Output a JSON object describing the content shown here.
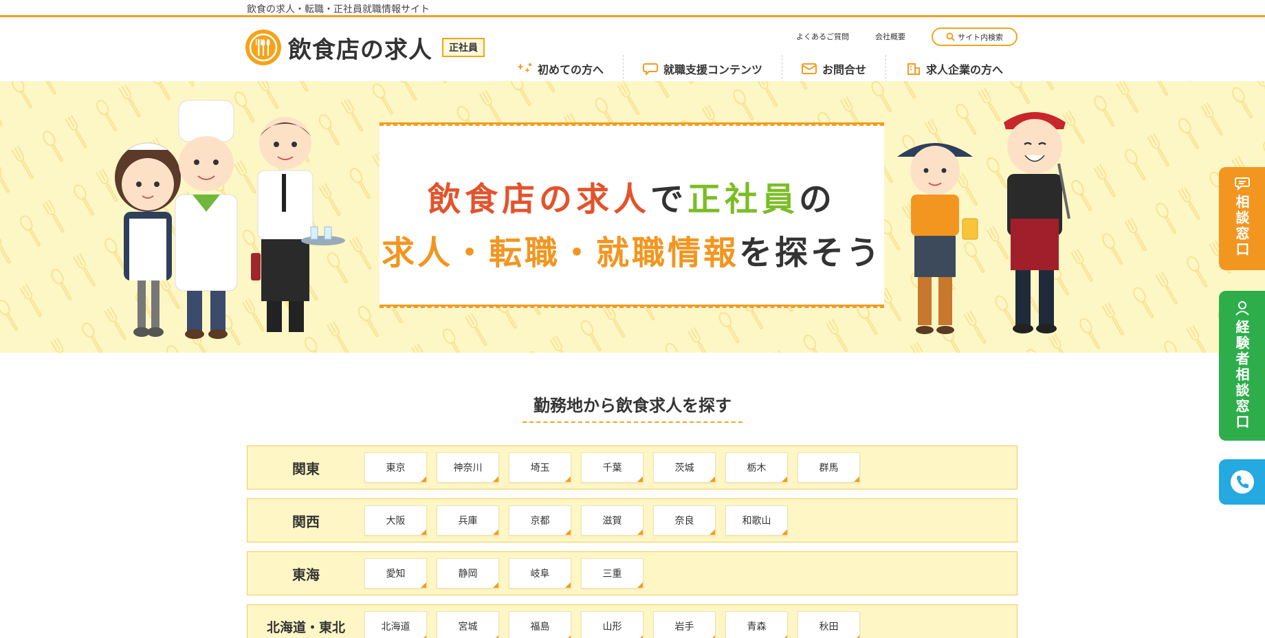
{
  "topbar": {
    "tagline": "飲食の求人・転職・正社員就職情報サイト"
  },
  "header": {
    "logo_text": "飲食店の求人",
    "logo_badge": "正社員",
    "util_links": [
      "よくあるご質問",
      "会社概要"
    ],
    "search_label": "サイト内検索",
    "nav": [
      {
        "label": "初めての方へ",
        "icon": "sparkle-icon"
      },
      {
        "label": "就職支援コンテンツ",
        "icon": "chat-bubble-icon"
      },
      {
        "label": "お問合せ",
        "icon": "mail-icon"
      },
      {
        "label": "求人企業の方へ",
        "icon": "building-icon"
      }
    ]
  },
  "hero": {
    "line1": {
      "a": "飲食店の求人",
      "b": "で",
      "c": "正社員",
      "d": "の"
    },
    "line2": {
      "a": "求人・転職・就職情報",
      "b": "を探そう"
    }
  },
  "section": {
    "title": "勤務地から飲食求人を探す"
  },
  "regions": [
    {
      "name": "関東",
      "prefs": [
        "東京",
        "神奈川",
        "埼玉",
        "千葉",
        "茨城",
        "栃木",
        "群馬"
      ]
    },
    {
      "name": "関西",
      "prefs": [
        "大阪",
        "兵庫",
        "京都",
        "滋賀",
        "奈良",
        "和歌山"
      ]
    },
    {
      "name": "東海",
      "prefs": [
        "愛知",
        "静岡",
        "岐阜",
        "三重"
      ]
    },
    {
      "name": "北海道・東北",
      "prefs": [
        "北海道",
        "宮城",
        "福島",
        "山形",
        "岩手",
        "青森",
        "秋田"
      ]
    }
  ],
  "sidetabs": {
    "consult": "相談窓口",
    "experienced": "経験者相談窓口"
  },
  "colors": {
    "accent": "#f39c1f",
    "hero_bg": "#fdf7c6",
    "green_tab": "#2eae4b",
    "blue_tab": "#24a9e1",
    "hero_red": "#e2542c",
    "hero_green": "#7cbd26"
  }
}
